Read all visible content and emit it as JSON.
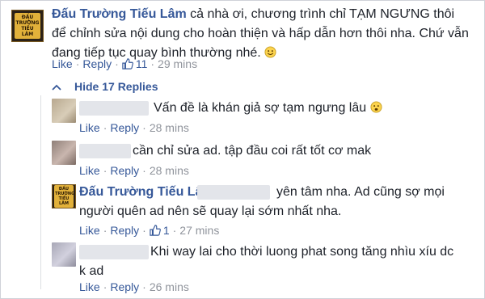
{
  "page_name": "Đấu Trường Tiếu Lâm",
  "logo_text": "ĐẤU TRƯỜNG TIẾU LÂM",
  "actions": {
    "like": "Like",
    "reply": "Reply",
    "dot": "·"
  },
  "main_comment": {
    "text": "cả nhà ơi, chương trình chỉ TẠM NGƯNG thôi để chỉnh sửa nội dung cho hoàn thiện và hấp dẫn hơn thôi nha. Chứ vẫn đang tiếp tục quay bình thường nhé.",
    "like_count": "11",
    "time": "29 mins"
  },
  "hide_replies": "Hide 17 Replies",
  "replies": [
    {
      "text": "Vấn đề là khán giả sợ tạm ngưng lâu",
      "time": "28 mins"
    },
    {
      "text": "cần chỉ sửa ad. tập đầu coi rất tốt cơ mak",
      "time": "28 mins"
    },
    {
      "text": "yên tâm nha. Ad cũng sợ mọi người quên ad nên sẽ quay lại sớm nhất nha.",
      "time": "27 mins",
      "like_count": "1"
    },
    {
      "text": "Khi way lai cho thời luong phat song tăng nhìu xíu dc k ad",
      "time": "26 mins"
    }
  ],
  "colors": {
    "link": "#365899",
    "muted": "#90949c",
    "text": "#1d2129"
  }
}
